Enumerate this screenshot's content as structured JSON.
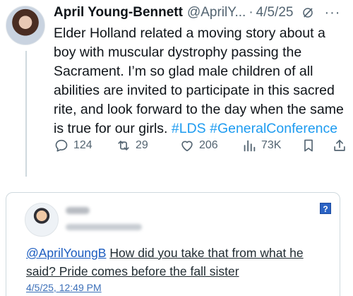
{
  "post": {
    "name": "April Young-Bennett",
    "handle": "@AprilY...",
    "separator": "·",
    "date": "4/5/25",
    "more_label": "···",
    "body": "Elder Holland related a moving story about a boy with muscular dystrophy passing the Sacrament. I’m so glad male children of all abilities are invited to participate in this sacred rite, and look forward to the day when the same is true for our girls.",
    "hashtags": [
      "#LDS",
      "#GeneralConference"
    ],
    "actions": {
      "replies": "124",
      "reposts": "29",
      "likes": "206",
      "views": "73K"
    }
  },
  "reply_card": {
    "help_label": "?",
    "mention": "@AprilYoungB",
    "text": "How did you take that from what he said? Pride comes before the fall sister",
    "timestamp": "4/5/25, 12:49 PM"
  },
  "colors": {
    "accent": "#1d9bf0",
    "muted": "#536471",
    "link": "#1a5bbf"
  }
}
